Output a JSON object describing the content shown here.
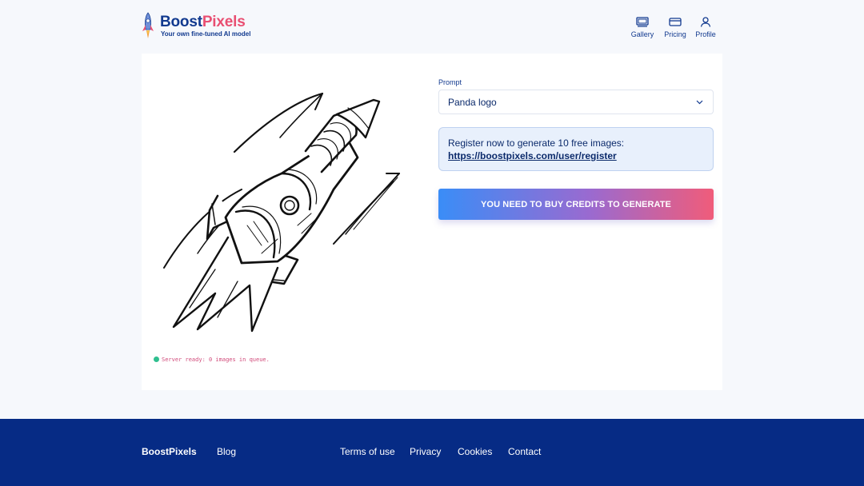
{
  "header": {
    "logo": {
      "title_part1": "Boost",
      "title_part2": "Pixels",
      "subtitle": "Your own fine-tuned AI model",
      "icon": "rocket-icon"
    },
    "nav": [
      {
        "label": "Gallery",
        "icon": "gallery-icon"
      },
      {
        "label": "Pricing",
        "icon": "card-icon"
      },
      {
        "label": "Profile",
        "icon": "user-icon"
      }
    ]
  },
  "main": {
    "image_alt": "rocket sketch illustration",
    "status": "Server ready: 0 images in queue.",
    "prompt": {
      "label": "Prompt",
      "value": "Panda logo"
    },
    "notice": {
      "text": "Register now to generate 10 free images:",
      "link": "https://boostpixels.com/user/register"
    },
    "cta": "YOU NEED TO BUY CREDITS TO GENERATE"
  },
  "footer": {
    "brand": "BoostPixels",
    "links": [
      "Blog",
      "Terms of use",
      "Privacy",
      "Cookies",
      "Contact"
    ]
  },
  "colors": {
    "primary": "#123a8f",
    "accent": "#e94f72",
    "footer_bg": "#062b85",
    "status_dot": "#2fbf8f",
    "gradient_start": "#3a8df7",
    "gradient_end": "#f05c7a"
  }
}
